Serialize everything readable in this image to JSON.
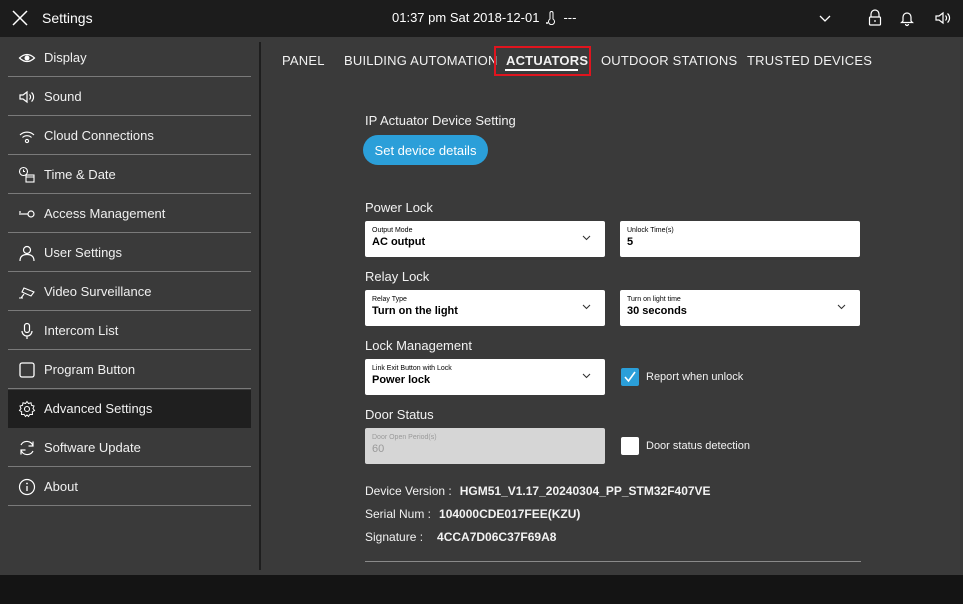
{
  "topbar": {
    "title": "Settings",
    "datetime": "01:37 pm  Sat 2018-12-01",
    "temperature": "---",
    "icons": [
      "close-icon",
      "thermometer-icon",
      "chevron-down-icon",
      "lock-icon",
      "bell-icon",
      "speaker-icon"
    ]
  },
  "sidebar": {
    "items": [
      {
        "label": "Display",
        "icon": "eye-icon"
      },
      {
        "label": "Sound",
        "icon": "speaker-icon"
      },
      {
        "label": "Cloud Connections",
        "icon": "wifi-icon"
      },
      {
        "label": "Time & Date",
        "icon": "clock-calendar-icon"
      },
      {
        "label": "Access Management",
        "icon": "key-icon"
      },
      {
        "label": "User Settings",
        "icon": "user-icon"
      },
      {
        "label": "Video Surveillance",
        "icon": "camera-icon"
      },
      {
        "label": "Intercom List",
        "icon": "microphone-icon"
      },
      {
        "label": "Program Button",
        "icon": "square-icon"
      },
      {
        "label": "Advanced Settings",
        "icon": "gear-icon",
        "active": true
      },
      {
        "label": "Software Update",
        "icon": "refresh-icon"
      },
      {
        "label": "About",
        "icon": "info-icon"
      }
    ]
  },
  "tabs": [
    {
      "label": "PANEL"
    },
    {
      "label": "BUILDING AUTOMATION"
    },
    {
      "label": "ACTUATORS",
      "active": true
    },
    {
      "label": "OUTDOOR STATIONS"
    },
    {
      "label": "TRUSTED DEVICES"
    }
  ],
  "content": {
    "ip_section": "IP Actuator Device Setting",
    "set_device_button": "Set device details",
    "power_lock_section": "Power Lock",
    "output_mode": {
      "label": "Output Mode",
      "value": "AC output"
    },
    "unlock_time": {
      "label": "Unlock Time(s)",
      "value": "5"
    },
    "relay_lock_section": "Relay Lock",
    "relay_type": {
      "label": "Relay Type",
      "value": "Turn on the light"
    },
    "turn_on_light_time": {
      "label": "Turn on light time",
      "value": "30 seconds"
    },
    "lock_mgmt_section": "Lock Management",
    "link_exit_button": {
      "label": "Link Exit Button with Lock",
      "value": "Power lock"
    },
    "report_when_unlock": {
      "label": "Report when unlock",
      "checked": true
    },
    "door_status_section": "Door Status",
    "door_open_period": {
      "label": "Door Open Period(s)",
      "value": "60",
      "disabled": true
    },
    "door_status_detection": {
      "label": "Door status detection",
      "checked": false
    },
    "device_version": {
      "label": "Device Version :",
      "value": "HGM51_V1.17_20240304_PP_STM32F407VE"
    },
    "serial_num": {
      "label": "Serial Num :",
      "value": "104000CDE017FEE(KZU)"
    },
    "signature": {
      "label": "Signature :",
      "value": "4CCA7D06C37F69A8"
    }
  },
  "colors": {
    "accent": "#2b9fd9",
    "highlight": "#e0141e",
    "background": "#3a3a3a",
    "topbar": "#1c1c1c"
  }
}
